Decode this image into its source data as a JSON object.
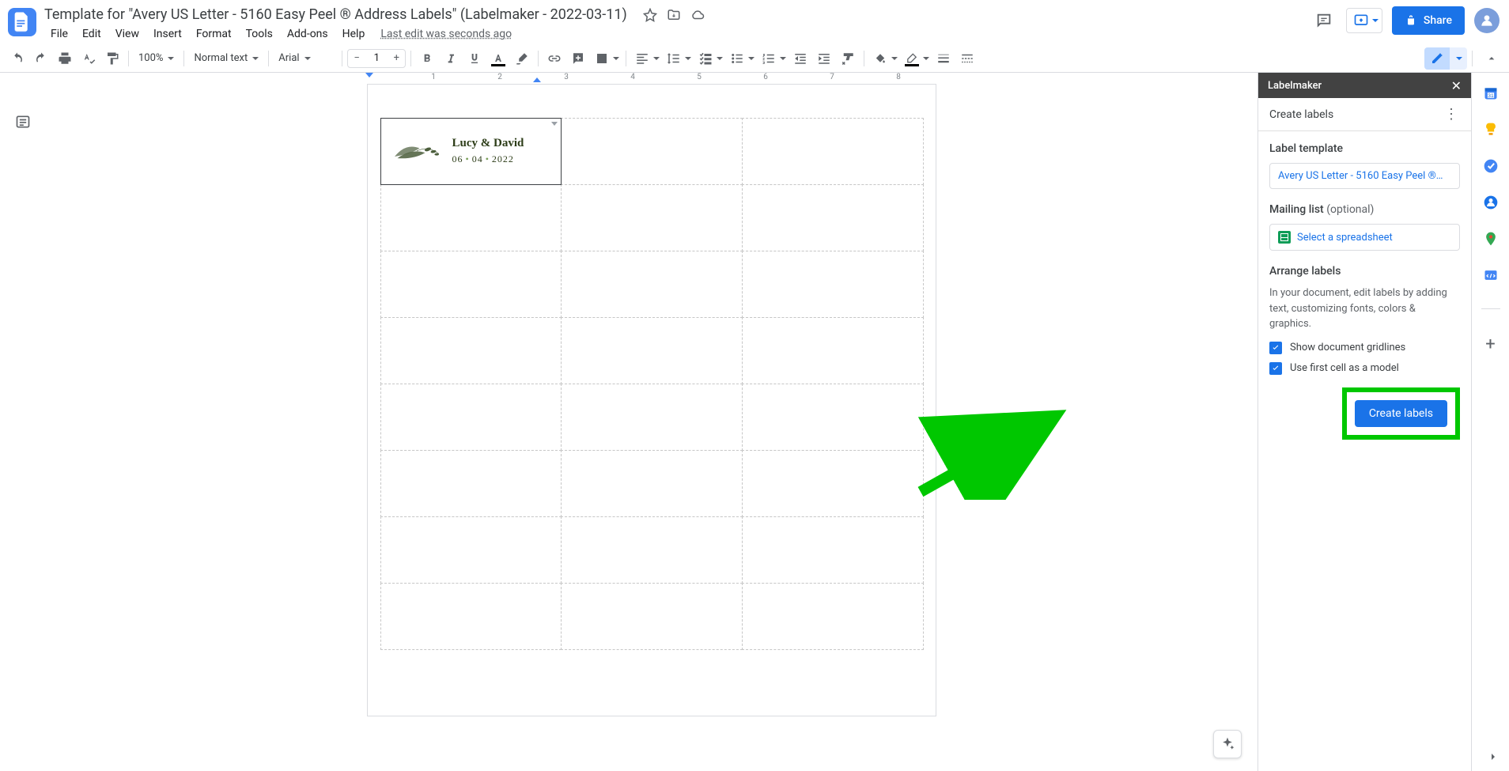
{
  "doc": {
    "title": "Template for \"Avery US Letter - 5160 Easy Peel ® Address Labels\" (Labelmaker - 2022-03-11)",
    "last_edit": "Last edit was seconds ago"
  },
  "menus": [
    "File",
    "Edit",
    "View",
    "Insert",
    "Format",
    "Tools",
    "Add-ons",
    "Help"
  ],
  "toolbar": {
    "zoom": "100%",
    "style": "Normal text",
    "font": "Arial",
    "font_size": "1"
  },
  "share": {
    "label": "Share"
  },
  "ruler_numbers": [
    "1",
    "2",
    "3",
    "4",
    "5",
    "6",
    "7",
    "8"
  ],
  "label_card": {
    "names": "Lucy & David",
    "date_month": "06",
    "date_day": "04",
    "date_year": "2022"
  },
  "sidebar": {
    "title": "Labelmaker",
    "heading": "Create labels",
    "template_section": "Label template",
    "template_value": "Avery US Letter - 5160 Easy Peel ®…",
    "mailing_section": "Mailing list",
    "mailing_optional": "(optional)",
    "spreadsheet_label": "Select a spreadsheet",
    "arrange_section": "Arrange labels",
    "arrange_desc": "In your document, edit labels by adding text, customizing fonts, colors & graphics.",
    "check_gridlines": "Show document gridlines",
    "check_first_cell": "Use first cell as a model",
    "create_button": "Create labels"
  },
  "icons": {
    "calendar": "calendar-icon",
    "keep": "keep-icon",
    "tasks": "tasks-icon",
    "contacts": "contacts-icon",
    "maps": "maps-icon",
    "interview": "assistant-icon"
  }
}
